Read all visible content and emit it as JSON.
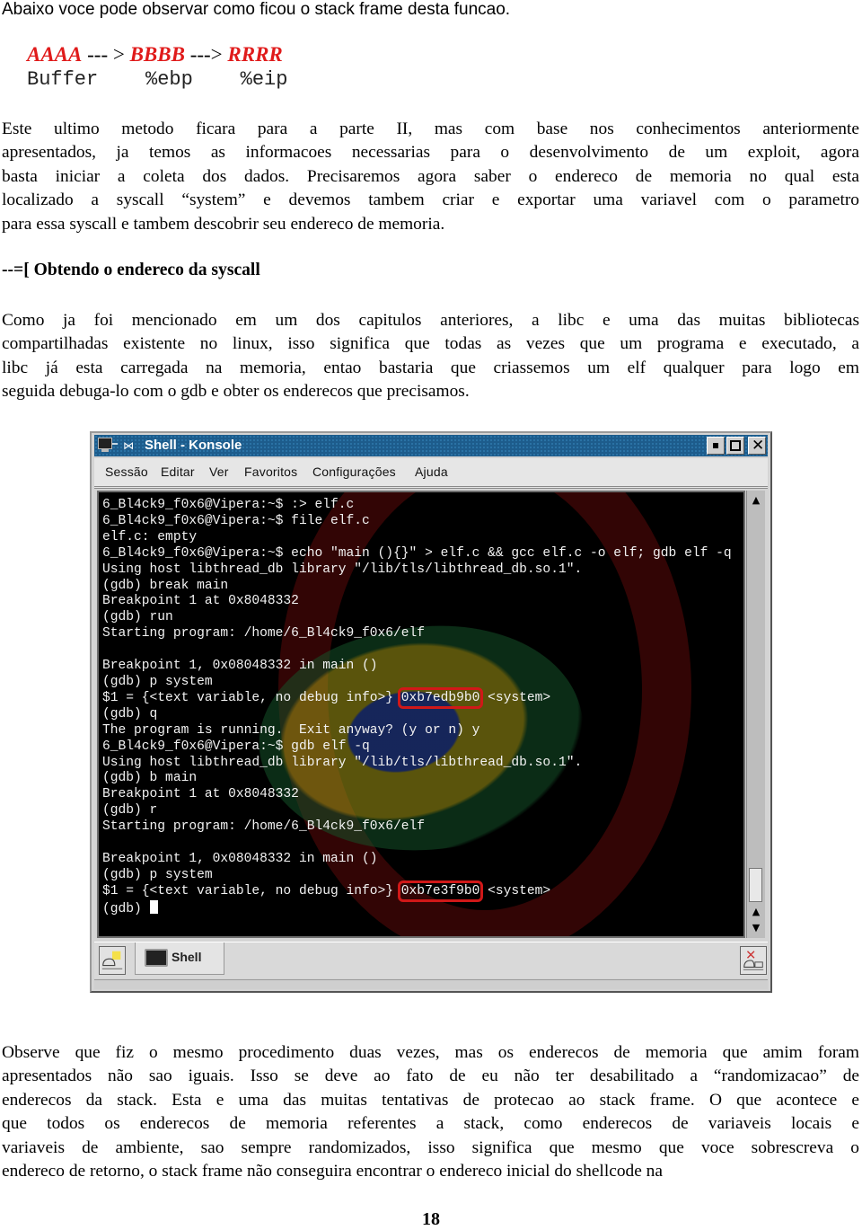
{
  "document": {
    "intro": "Abaixo voce pode observar como ficou o stack frame desta funcao.",
    "stack_frame": {
      "cells": [
        "AAAA",
        "BBBB",
        "RRRR"
      ],
      "arrows": [
        " --- > ",
        " ---> "
      ],
      "registers_line": "Buffer    %ebp    %eip"
    },
    "paragraph1": [
      "Este ultimo metodo ficara para a parte II, mas com base nos conhecimentos anteriormente",
      "apresentados, ja temos as informacoes necessarias para o desenvolvimento de um exploit, agora",
      "basta iniciar a coleta dos dados. Precisaremos agora saber o endereco de memoria no qual esta",
      "localizado a syscall “system” e devemos tambem criar e exportar uma variavel com o parametro",
      "para essa syscall e tambem descobrir seu endereco de memoria."
    ],
    "section_heading": "--=[ Obtendo o endereco da syscall",
    "paragraph2": [
      "Como ja foi mencionado em um dos capitulos anteriores,  a libc e uma das muitas bibliotecas",
      "compartilhadas existente no linux, isso significa que todas as vezes que um programa e executado, a",
      "libc já esta carregada na memoria, entao bastaria que criassemos um elf qualquer para logo em",
      "seguida debuga-lo com o gdb e obter os enderecos que precisamos."
    ],
    "paragraph3": [
      "Observe que fiz o mesmo procedimento duas vezes, mas os enderecos de memoria que amim foram",
      "apresentados não sao iguais. Isso se deve ao fato de eu não ter desabilitado a “randomizacao” de",
      "enderecos da stack. Esta e uma das muitas tentativas de protecao ao stack frame. O que acontece e",
      "que todos os enderecos de memoria referentes a stack, como enderecos de variaveis locais e",
      "variaveis de ambiente, sao sempre randomizados, isso significa que mesmo que voce sobrescreva o",
      "endereco de retorno, o stack frame não conseguira encontrar o endereco inicial do shellcode na"
    ],
    "page_number": "18",
    "accent_color": "#e01b1b"
  },
  "konsole": {
    "window_title": "Shell - Konsole",
    "window_buttons": {
      "minimize": "minimize",
      "maximize": "maximize",
      "close": "✕"
    },
    "menu": [
      "Sessão",
      "Editar",
      "Ver",
      "Favoritos",
      "Configurações",
      "Ajuda"
    ],
    "terminal_lines": [
      "6_Bl4ck9_f0x6@Vipera:~$ :> elf.c",
      "6_Bl4ck9_f0x6@Vipera:~$ file elf.c",
      "elf.c: empty",
      "6_Bl4ck9_f0x6@Vipera:~$ echo \"main (){}\" > elf.c && gcc elf.c -o elf; gdb elf -q",
      "Using host libthread_db library \"/lib/tls/libthread_db.so.1\".",
      "(gdb) break main",
      "Breakpoint 1 at 0x8048332",
      "(gdb) run",
      "Starting program: /home/6_Bl4ck9_f0x6/elf",
      "",
      "Breakpoint 1, 0x08048332 in main ()",
      "(gdb) p system",
      {
        "pre": "$1 = {<text variable, no debug info>} ",
        "highlight": "0xb7edb9b0",
        "post": " <system>"
      },
      "(gdb) q",
      "The program is running.  Exit anyway? (y or n) y",
      "6_Bl4ck9_f0x6@Vipera:~$ gdb elf -q",
      "Using host libthread_db library \"/lib/tls/libthread_db.so.1\".",
      "(gdb) b main",
      "Breakpoint 1 at 0x8048332",
      "(gdb) r",
      "Starting program: /home/6_Bl4ck9_f0x6/elf",
      "",
      "Breakpoint 1, 0x08048332 in main ()",
      "(gdb) p system",
      {
        "pre": "$1 = {<text variable, no debug info>} ",
        "highlight": "0xb7e3f9b0",
        "post": " <system>"
      },
      {
        "pre": "(gdb) ",
        "cursor": true
      }
    ],
    "highlight_color": "#d01818",
    "tabs": [
      {
        "label": "Shell",
        "icon": "terminal-icon"
      }
    ],
    "scrollbar": {
      "position_fraction": 1.0
    }
  }
}
